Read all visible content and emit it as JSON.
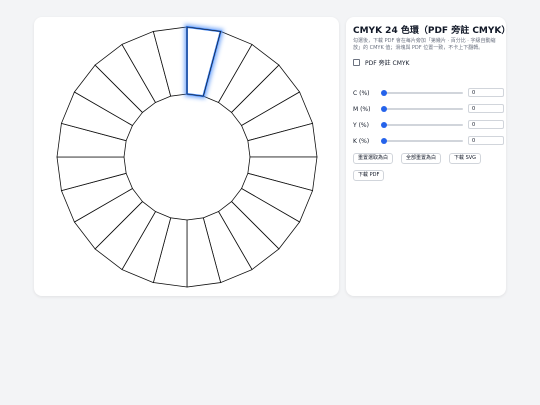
{
  "panel": {
    "title": "CMYK 24 色環（PDF 旁註 CMYK）",
    "description": "勾選後，下載 PDF 會在每片旁加「第幾片 · 百分比 · 字級自動縮放」的 CMYK 值；滑塊與 PDF 位置一致，不卡上下翻轉。",
    "annotate_label": "PDF 旁註 CMYK",
    "annotate_checked": false,
    "sliders": [
      {
        "label": "C (%)",
        "value": "0"
      },
      {
        "label": "M (%)",
        "value": "0"
      },
      {
        "label": "Y (%)",
        "value": "0"
      },
      {
        "label": "K (%)",
        "value": "0"
      }
    ],
    "buttons": {
      "reset_selected": "重置選取為白",
      "reset_all": "全部重置為白",
      "download_svg": "下載 SVG",
      "download_pdf": "下載 PDF"
    }
  },
  "wheel": {
    "segments": 24,
    "selected_index": 0,
    "selected_color": "#3b82f6",
    "fill_color": "#ffffff",
    "stroke_color": "#111111"
  }
}
